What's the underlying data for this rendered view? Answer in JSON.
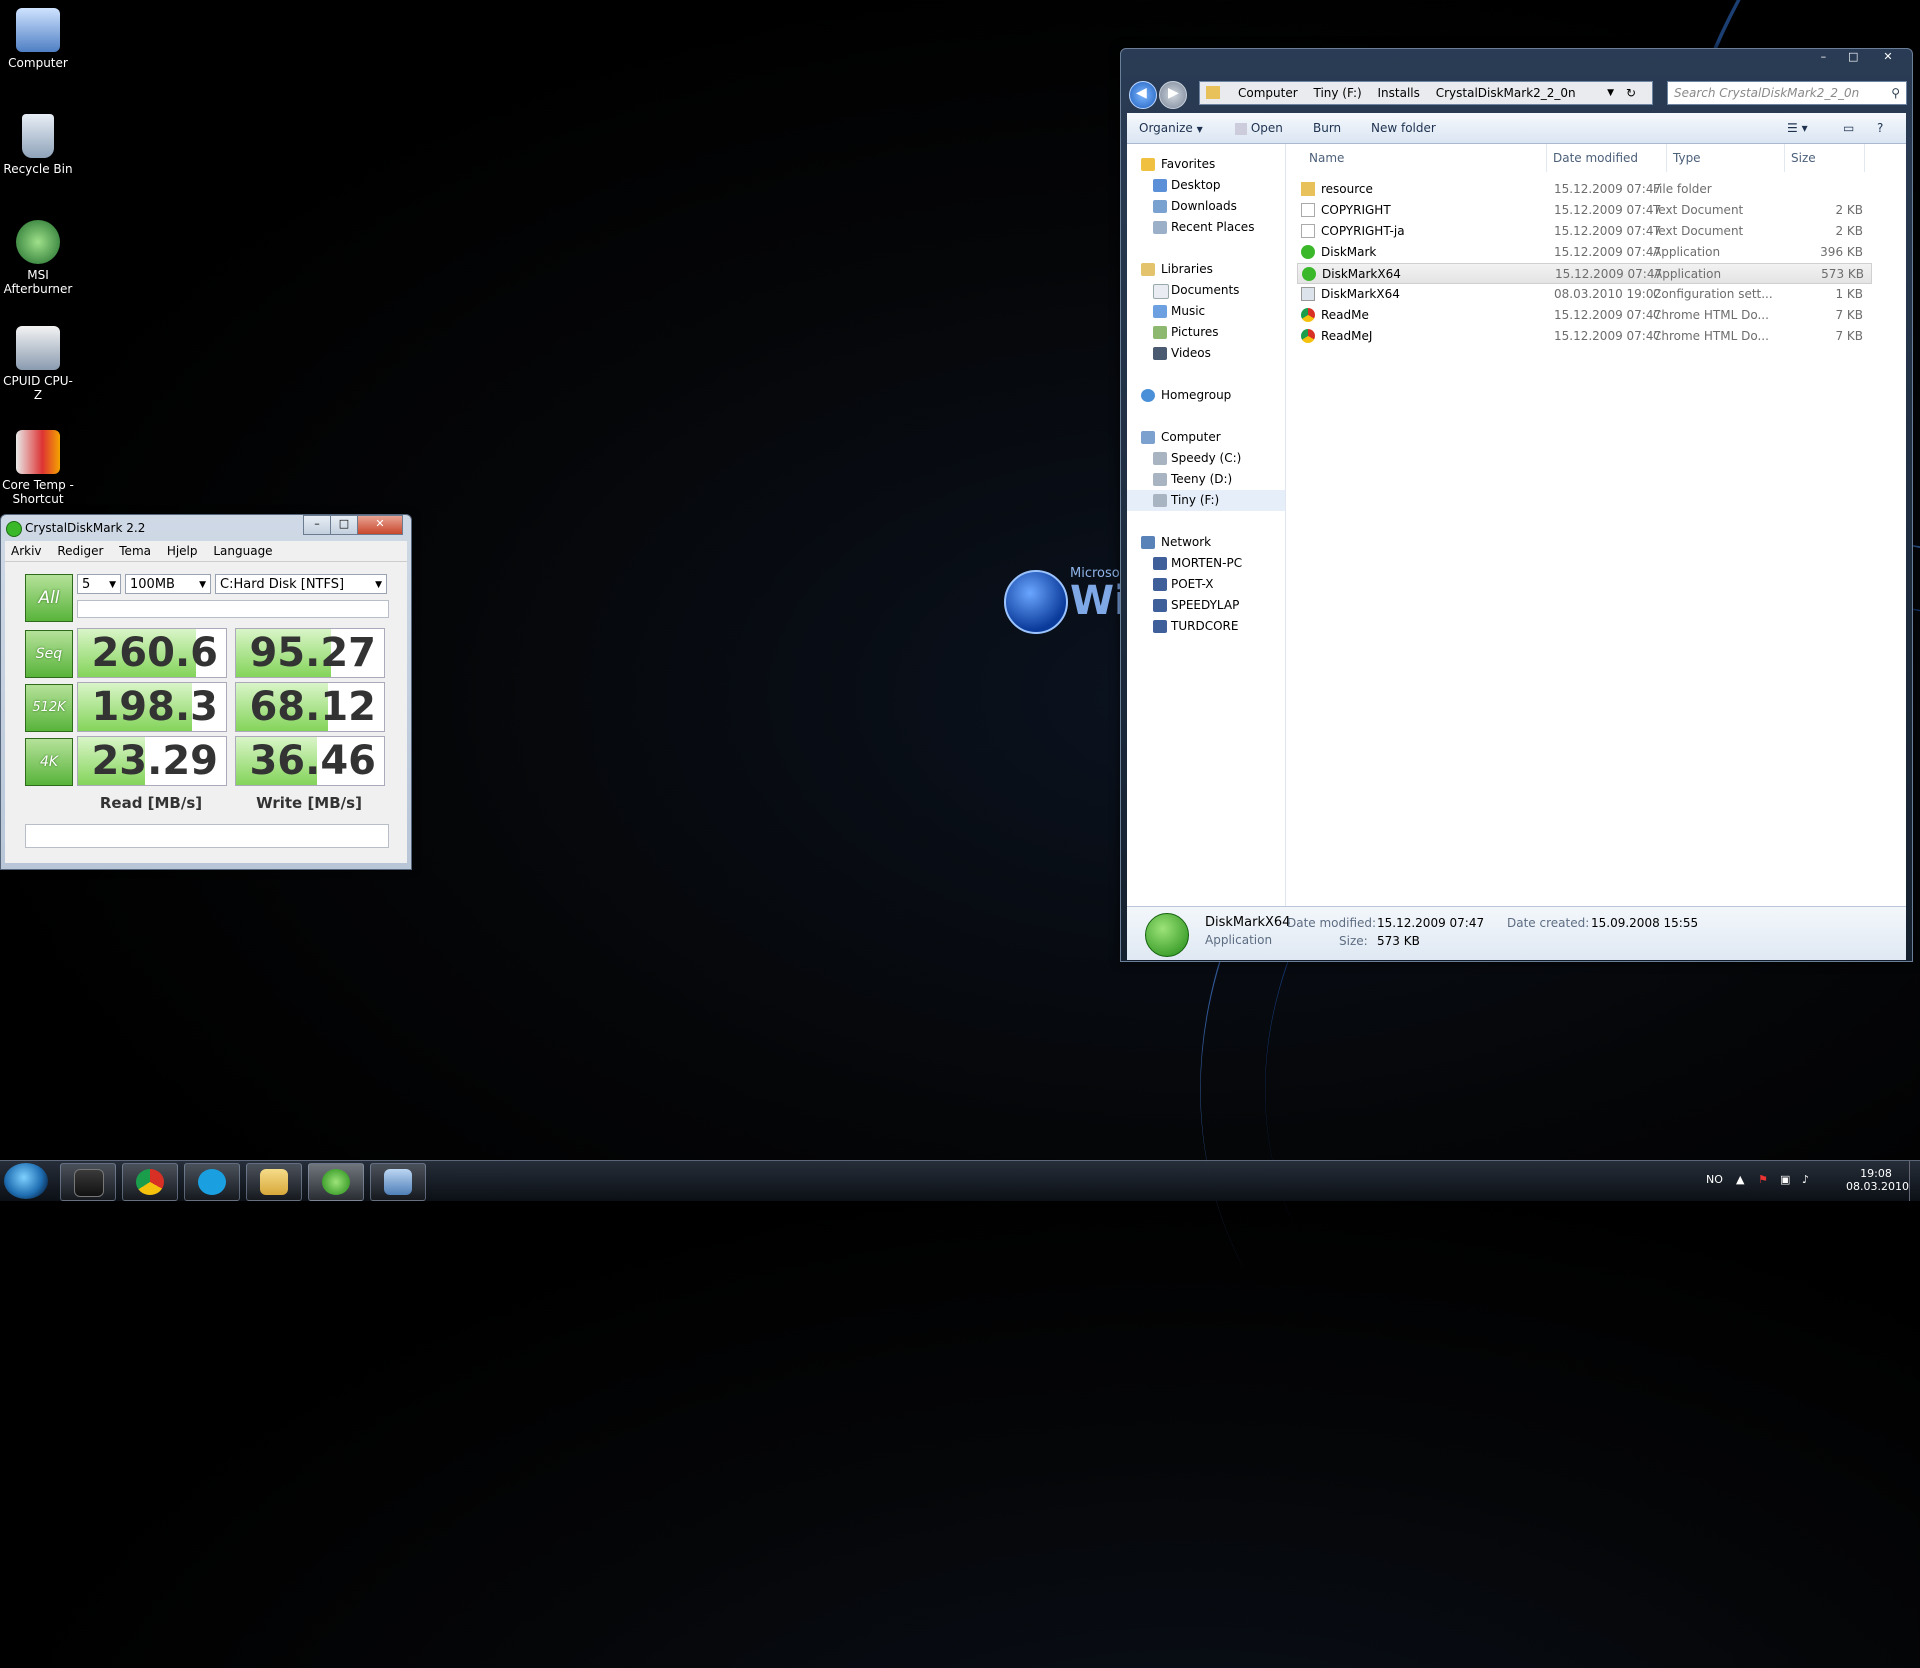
{
  "desktop": {
    "icons": [
      {
        "label": "Computer",
        "icon": "computer-icon"
      },
      {
        "label": "Recycle Bin",
        "icon": "recycle-bin-icon"
      },
      {
        "label": "MSI Afterburner",
        "icon": "msi-afterburner-icon"
      },
      {
        "label": "CPUID CPU-Z",
        "icon": "cpuz-icon"
      },
      {
        "label": "Core Temp - Shortcut",
        "icon": "core-temp-icon"
      }
    ],
    "wallpaper_text": {
      "microsoft": "Microsoft",
      "win": "Win"
    }
  },
  "cdm": {
    "title": "CrystalDiskMark 2.2",
    "menu": [
      "Arkiv",
      "Rediger",
      "Tema",
      "Hjelp",
      "Language"
    ],
    "all_label": "All",
    "runs": "5",
    "size": "100MB",
    "drive": "C:Hard Disk [NTFS]",
    "rows": [
      {
        "label": "Seq",
        "read": "260.6",
        "write": "95.27",
        "read_fill": 0.8,
        "write_fill": 0.64
      },
      {
        "label": "512K",
        "read": "198.3",
        "write": "68.12",
        "read_fill": 0.77,
        "write_fill": 0.62
      },
      {
        "label": "4K",
        "read": "23.29",
        "write": "36.46",
        "read_fill": 0.45,
        "write_fill": 0.55
      }
    ],
    "read_header": "Read [MB/s]",
    "write_header": "Write [MB/s]"
  },
  "explorer": {
    "breadcrumb": [
      "Computer",
      "Tiny (F:)",
      "Installs",
      "CrystalDiskMark2_2_0n"
    ],
    "search_placeholder": "Search CrystalDiskMark2_2_0n",
    "toolbar": {
      "organize": "Organize",
      "open": "Open",
      "burn": "Burn",
      "new_folder": "New folder"
    },
    "nav": [
      {
        "label": "Favorites",
        "level": 0
      },
      {
        "label": "Desktop",
        "level": 1
      },
      {
        "label": "Downloads",
        "level": 1
      },
      {
        "label": "Recent Places",
        "level": 1
      },
      {
        "label": "Libraries",
        "level": 0
      },
      {
        "label": "Documents",
        "level": 1
      },
      {
        "label": "Music",
        "level": 1
      },
      {
        "label": "Pictures",
        "level": 1
      },
      {
        "label": "Videos",
        "level": 1
      },
      {
        "label": "Homegroup",
        "level": 0
      },
      {
        "label": "Computer",
        "level": 0
      },
      {
        "label": "Speedy (C:)",
        "level": 1
      },
      {
        "label": "Teeny (D:)",
        "level": 1
      },
      {
        "label": "Tiny (F:)",
        "level": 1
      },
      {
        "label": "Network",
        "level": 0
      },
      {
        "label": "MORTEN-PC",
        "level": 1
      },
      {
        "label": "POET-X",
        "level": 1
      },
      {
        "label": "SPEEDYLAP",
        "level": 1
      },
      {
        "label": "TURDCORE",
        "level": 1
      }
    ],
    "columns": {
      "name": "Name",
      "date": "Date modified",
      "type": "Type",
      "size": "Size"
    },
    "files": [
      {
        "name": "resource",
        "date": "15.12.2009 07:47",
        "type": "File folder",
        "size": "",
        "icon": "folder-icon"
      },
      {
        "name": "COPYRIGHT",
        "date": "15.12.2009 07:47",
        "type": "Text Document",
        "size": "2 KB",
        "icon": "text-file-icon"
      },
      {
        "name": "COPYRIGHT-ja",
        "date": "15.12.2009 07:47",
        "type": "Text Document",
        "size": "2 KB",
        "icon": "text-file-icon"
      },
      {
        "name": "DiskMark",
        "date": "15.12.2009 07:47",
        "type": "Application",
        "size": "396 KB",
        "icon": "diskmark-app-icon"
      },
      {
        "name": "DiskMarkX64",
        "date": "15.12.2009 07:47",
        "type": "Application",
        "size": "573 KB",
        "icon": "diskmark-app-icon"
      },
      {
        "name": "DiskMarkX64",
        "date": "08.03.2010 19:02",
        "type": "Configuration sett...",
        "size": "1 KB",
        "icon": "config-file-icon"
      },
      {
        "name": "ReadMe",
        "date": "15.12.2009 07:47",
        "type": "Chrome HTML Do...",
        "size": "7 KB",
        "icon": "chrome-html-icon"
      },
      {
        "name": "ReadMeJ",
        "date": "15.12.2009 07:47",
        "type": "Chrome HTML Do...",
        "size": "7 KB",
        "icon": "chrome-html-icon"
      }
    ],
    "details": {
      "name": "DiskMarkX64",
      "kind": "Application",
      "modified_label": "Date modified:",
      "modified": "15.12.2009 07:47",
      "created_label": "Date created:",
      "created": "15.09.2008 15:55",
      "size_label": "Size:",
      "size": "573 KB"
    }
  },
  "taskbar": {
    "language": "NO",
    "time": "19:08",
    "date": "08.03.2010"
  }
}
